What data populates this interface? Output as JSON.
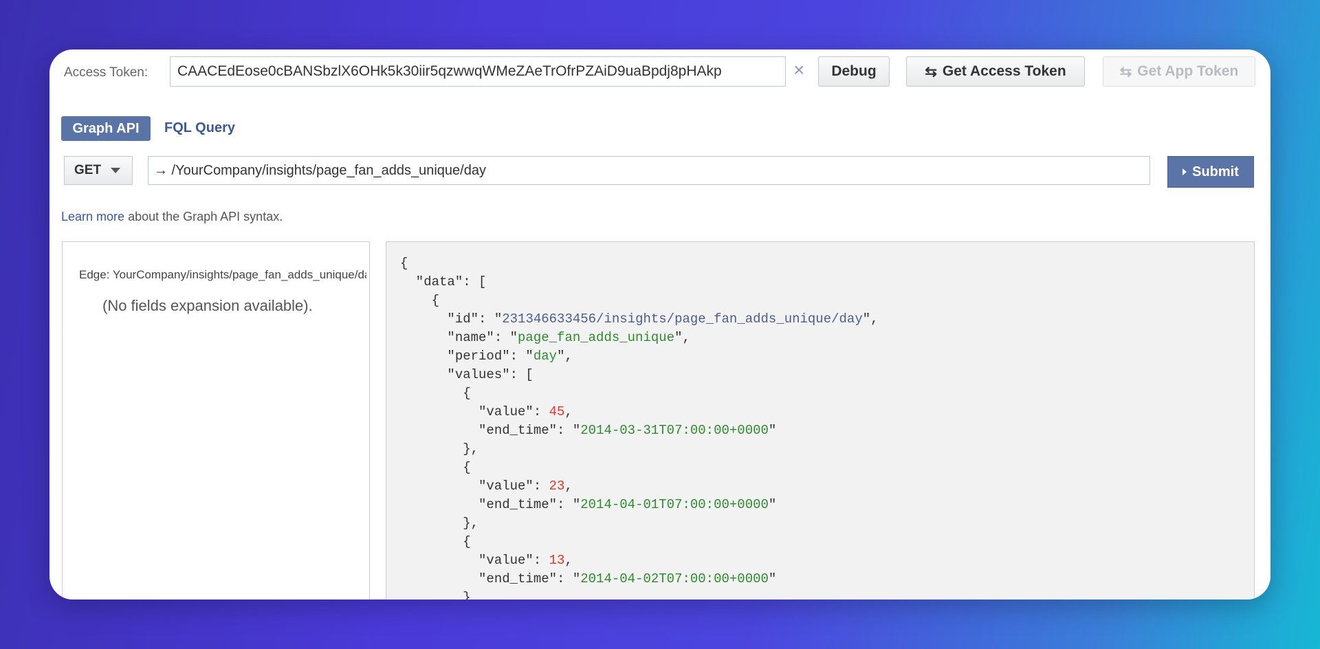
{
  "access_token": {
    "label": "Access Token:",
    "value": "CAACEdEose0cBANSbzlX6OHk5k30iir5qzwwqWMeZAeTrOfrPZAiD9uaBpdj8pHAkp"
  },
  "buttons": {
    "debug": "Debug",
    "get_access_token": "Get Access Token",
    "get_app_token": "Get App Token",
    "submit": "Submit"
  },
  "tabs": [
    {
      "label": "Graph API",
      "active": true
    },
    {
      "label": "FQL Query",
      "active": false
    }
  ],
  "query": {
    "method": "GET",
    "path": "→ /YourCompany/insights/page_fan_adds_unique/day"
  },
  "learn": {
    "link": "Learn more",
    "text": " about the Graph API syntax."
  },
  "left_panel": {
    "edge": "Edge:  YourCompany/insights/page_fan_adds_unique/day",
    "no_fields": "(No fields expansion available)."
  },
  "response": {
    "id": "231346633456/insights/page_fan_adds_unique/day",
    "name": "page_fan_adds_unique",
    "period": "day",
    "values": [
      {
        "value": "45",
        "end_time": "2014-03-31T07:00:00+0000"
      },
      {
        "value": "23",
        "end_time": "2014-04-01T07:00:00+0000"
      },
      {
        "value": "13",
        "end_time": "2014-04-02T07:00:00+0000"
      }
    ]
  },
  "colors": {
    "accent": "#5b74a8",
    "link": "#3b5998",
    "json_string": "#2e8b2e",
    "json_number": "#e0362c",
    "json_id": "#4b5e8c"
  },
  "icons": [
    "clear-icon",
    "swap-arrows-icon",
    "caret-down-icon",
    "play-icon"
  ]
}
